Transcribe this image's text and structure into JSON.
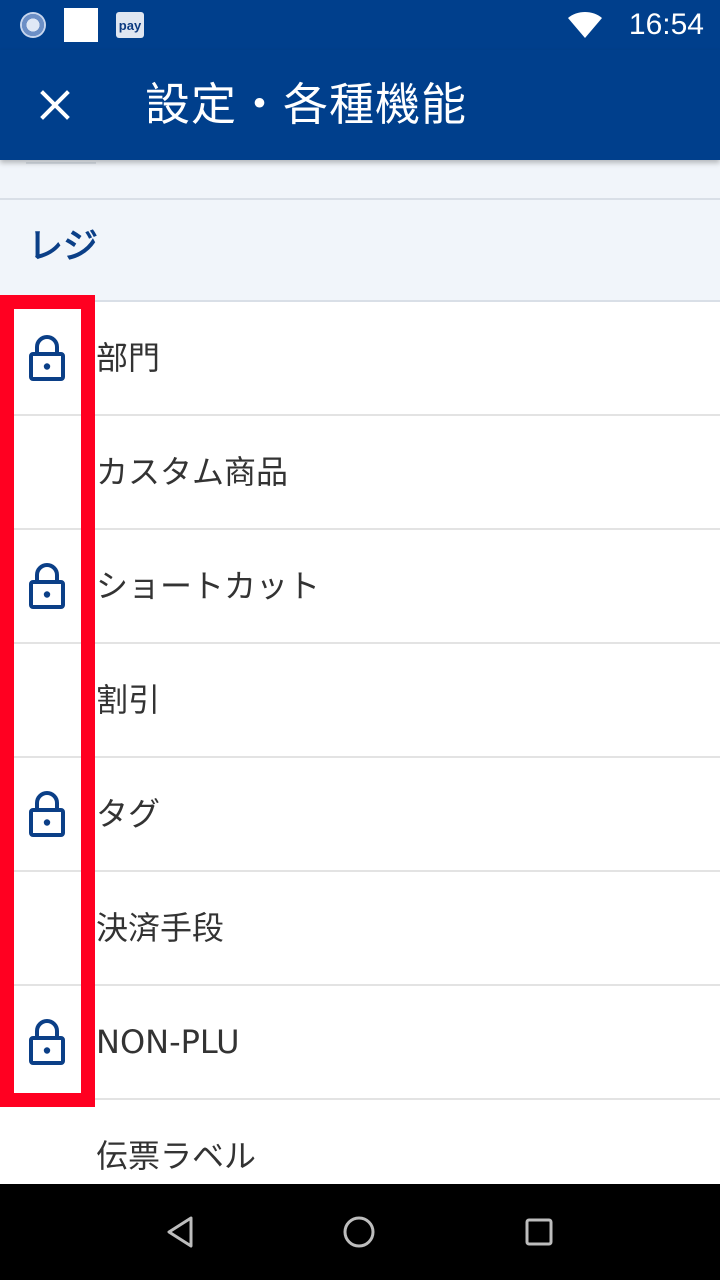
{
  "status_bar": {
    "time": "16:54",
    "icons": [
      "globe-icon",
      "blank-square-icon",
      "pay-icon",
      "wifi-icon"
    ],
    "pay_label": "pay"
  },
  "app_bar": {
    "title": "設定・各種機能",
    "close_icon": "close-icon"
  },
  "section": {
    "title": "レジ"
  },
  "items": [
    {
      "label": "部門",
      "locked": true
    },
    {
      "label": "カスタム商品",
      "locked": false
    },
    {
      "label": "ショートカット",
      "locked": true
    },
    {
      "label": "割引",
      "locked": false
    },
    {
      "label": "タグ",
      "locked": true
    },
    {
      "label": "決済手段",
      "locked": false
    },
    {
      "label": "NON-PLU",
      "locked": true
    },
    {
      "label": "伝票ラベル",
      "locked": false
    }
  ],
  "colors": {
    "primary": "#003f8c",
    "section_text": "#0b3f87",
    "highlight": "#ff0021",
    "lock_icon": "#0b3f87"
  },
  "nav_bar": {
    "icons": [
      "back-icon",
      "home-icon",
      "recents-icon"
    ]
  }
}
